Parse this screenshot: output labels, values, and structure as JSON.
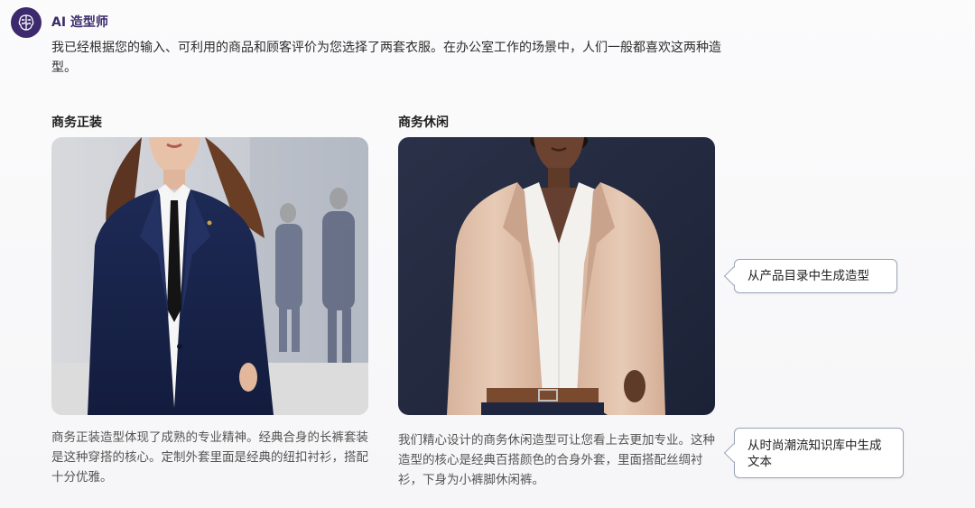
{
  "assistant": {
    "name": "AI 造型师",
    "avatar_icon": "brain-icon",
    "intro": "我已经根据您的输入、可利用的商品和顾客评价为您选择了两套衣服。在办公室工作的场景中，人们一般都喜欢这两种造型。"
  },
  "looks": [
    {
      "title": "商务正装",
      "image_icon": "business-formal-photo",
      "description": "商务正装造型体现了成熟的专业精神。经典合身的长裤套装是这种穿搭的核心。定制外套里面是经典的纽扣衬衫，搭配十分优雅。"
    },
    {
      "title": "商务休闲",
      "image_icon": "business-casual-photo",
      "description": "我们精心设计的商务休闲造型可让您看上去更加专业。这种造型的核心是经典百搭颜色的合身外套，里面搭配丝绸衬衫，下身为小裤脚休闲裤。"
    }
  ],
  "callouts": {
    "image_source": "从产品目录中生成造型",
    "text_source": "从时尚潮流知识库中生成文本"
  },
  "colors": {
    "accent": "#3d2a6e",
    "callout_border": "#9aa4b8"
  }
}
